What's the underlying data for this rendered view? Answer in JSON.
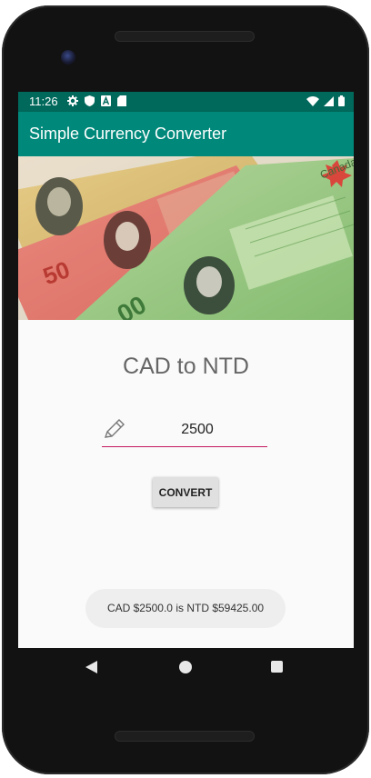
{
  "status_bar": {
    "time": "11:26",
    "icons_left": [
      "gear-icon",
      "shield-icon",
      "a-icon",
      "sd-card-icon"
    ],
    "icons_right": [
      "wifi-icon",
      "signal-icon",
      "battery-icon"
    ],
    "color": "#00695c"
  },
  "app_bar": {
    "title": "Simple Currency Converter",
    "color": "#00897b"
  },
  "main": {
    "heading": "CAD to NTD",
    "amount_value": "2500",
    "input_underline_color": "#c2185b",
    "convert_label": "CONVERT",
    "result_text": "CAD $2500.0 is NTD $59425.00",
    "banner_notes": [
      "50",
      "00",
      "Canada"
    ]
  },
  "nav": {
    "items": [
      "back-icon",
      "home-icon",
      "recents-icon"
    ]
  }
}
